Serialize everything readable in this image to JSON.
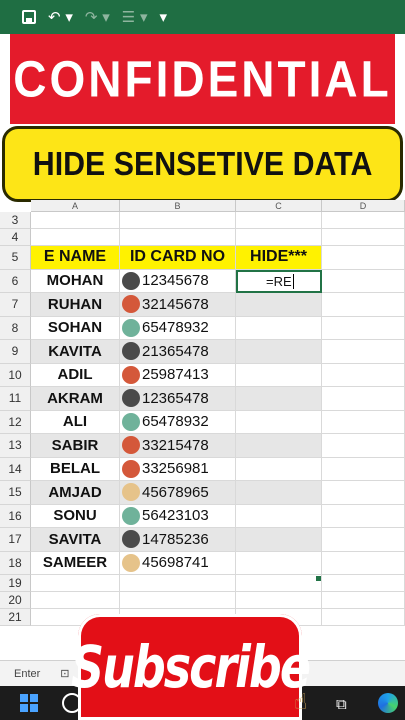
{
  "titlebar": {
    "icons": [
      "save-icon",
      "undo-icon",
      "redo-icon",
      "format-icon",
      "customize-icon"
    ]
  },
  "banners": {
    "red_text": "CONFIDENTIAL",
    "yellow_text": "HIDE SENSETIVE DATA"
  },
  "sheet": {
    "columns": [
      "A",
      "B",
      "C",
      "D"
    ],
    "rows": [
      {
        "num": "3"
      },
      {
        "num": "4"
      },
      {
        "num": "5",
        "a": "E NAME",
        "b": "ID CARD NO",
        "c": "HIDE***"
      },
      {
        "num": "6",
        "a": "MOHAN",
        "b": "12345678",
        "dot": "#4a4a4a",
        "c": "=RE"
      },
      {
        "num": "7",
        "a": "RUHAN",
        "b": "32145678",
        "dot": "#d4583a"
      },
      {
        "num": "8",
        "a": "SOHAN",
        "b": "65478932",
        "dot": "#6fb29a"
      },
      {
        "num": "9",
        "a": "KAVITA",
        "b": "21365478",
        "dot": "#4a4a4a"
      },
      {
        "num": "10",
        "a": "ADIL",
        "b": "25987413",
        "dot": "#d4583a"
      },
      {
        "num": "11",
        "a": "AKRAM",
        "b": "12365478",
        "dot": "#4a4a4a"
      },
      {
        "num": "12",
        "a": "ALI",
        "b": "65478932",
        "dot": "#6fb29a"
      },
      {
        "num": "13",
        "a": "SABIR",
        "b": "33215478",
        "dot": "#d4583a"
      },
      {
        "num": "14",
        "a": "BELAL",
        "b": "33256981",
        "dot": "#d4583a"
      },
      {
        "num": "15",
        "a": "AMJAD",
        "b": "45678965",
        "dot": "#e6c38a"
      },
      {
        "num": "16",
        "a": "SONU",
        "b": "56423103",
        "dot": "#6fb29a"
      },
      {
        "num": "17",
        "a": "SAVITA",
        "b": "14785236",
        "dot": "#4a4a4a"
      },
      {
        "num": "18",
        "a": "SAMEER",
        "b": "45698741",
        "dot": "#e6c38a"
      },
      {
        "num": "19"
      },
      {
        "num": "20"
      },
      {
        "num": "21"
      }
    ]
  },
  "statusbar": {
    "mode": "Enter"
  },
  "sticker": {
    "text": "Subscribe"
  },
  "colors": {
    "excel_green": "#1f6e43",
    "banner_red": "#e41b2b",
    "banner_yellow": "#fde517",
    "header_yellow": "#fff200",
    "subscribe_red": "#e30f17"
  }
}
